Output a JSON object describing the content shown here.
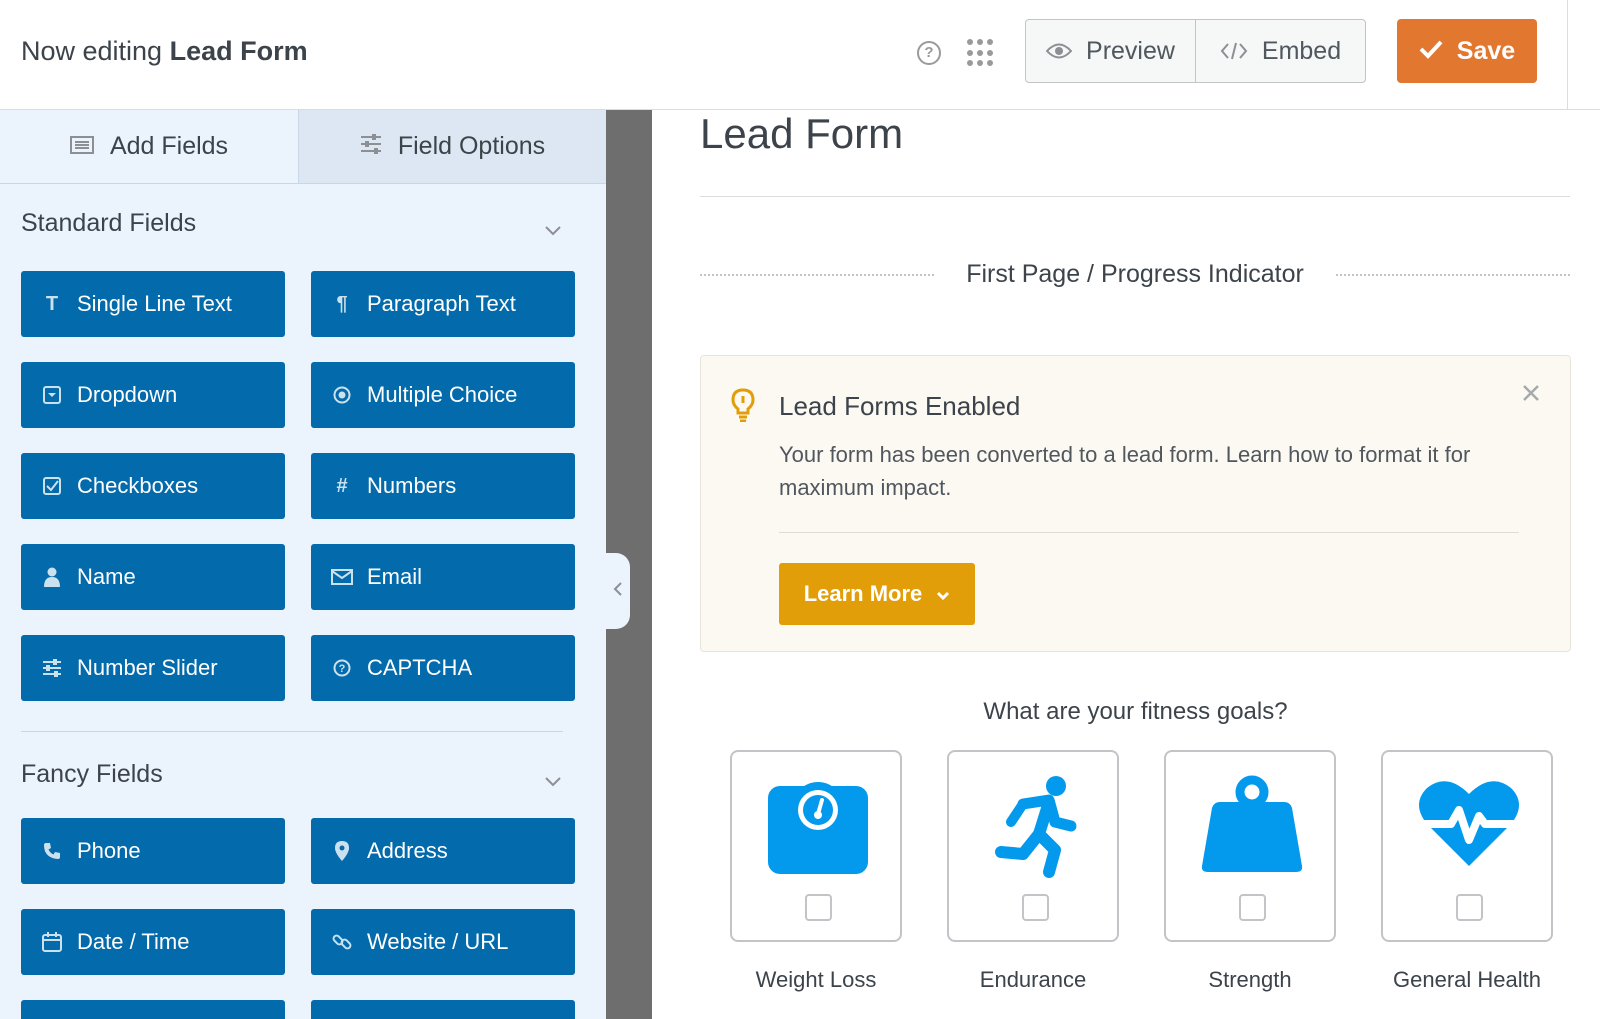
{
  "header": {
    "title_prefix": "Now editing",
    "form_name": "Lead Form",
    "preview_label": "Preview",
    "embed_label": "Embed",
    "save_label": "Save",
    "accent_color": "#e27730"
  },
  "sidebar": {
    "tabs": [
      {
        "label": "Add Fields",
        "icon": "list-icon",
        "active": true
      },
      {
        "label": "Field Options",
        "icon": "sliders-icon",
        "active": false
      }
    ],
    "standard": {
      "title": "Standard Fields",
      "fields": [
        {
          "label": "Single Line Text",
          "icon": "text-icon"
        },
        {
          "label": "Paragraph Text",
          "icon": "paragraph-icon"
        },
        {
          "label": "Dropdown",
          "icon": "dropdown-icon"
        },
        {
          "label": "Multiple Choice",
          "icon": "radio-icon"
        },
        {
          "label": "Checkboxes",
          "icon": "checkbox-icon"
        },
        {
          "label": "Numbers",
          "icon": "hash-icon"
        },
        {
          "label": "Name",
          "icon": "user-icon"
        },
        {
          "label": "Email",
          "icon": "envelope-icon"
        },
        {
          "label": "Number Slider",
          "icon": "sliders-icon"
        },
        {
          "label": "CAPTCHA",
          "icon": "question-circle-icon"
        }
      ]
    },
    "fancy": {
      "title": "Fancy Fields",
      "fields": [
        {
          "label": "Phone",
          "icon": "phone-icon"
        },
        {
          "label": "Address",
          "icon": "map-pin-icon"
        },
        {
          "label": "Date / Time",
          "icon": "calendar-icon"
        },
        {
          "label": "Website / URL",
          "icon": "link-icon"
        },
        {
          "label": "",
          "icon": ""
        },
        {
          "label": "",
          "icon": ""
        }
      ]
    },
    "button_color": "#036aab"
  },
  "form": {
    "title": "Lead Form",
    "page_break_label": "First Page / Progress Indicator",
    "notice": {
      "title": "Lead Forms Enabled",
      "text": "Your form has been converted to a lead form. Learn how to format it for maximum impact.",
      "button_label": "Learn More",
      "button_color": "#e29e08"
    },
    "question": "What are your fitness goals?",
    "choices": [
      {
        "label": "Weight Loss",
        "icon": "scale-icon"
      },
      {
        "label": "Endurance",
        "icon": "running-icon"
      },
      {
        "label": "Strength",
        "icon": "weight-icon"
      },
      {
        "label": "General Health",
        "icon": "heartbeat-icon"
      }
    ],
    "choice_icon_color": "#0399ed"
  }
}
